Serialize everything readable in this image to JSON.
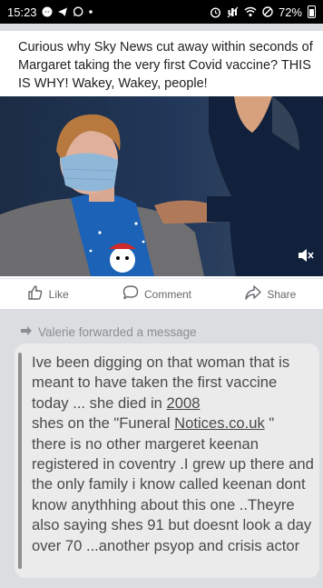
{
  "status_bar": {
    "time": "15:23",
    "battery": "72%",
    "left_icons": [
      "messenger-icon",
      "telegram-icon",
      "whatsapp-icon",
      "dot-icon"
    ],
    "right_icons": [
      "alarm-icon",
      "mute-icon",
      "wifi-icon",
      "do-not-disturb-icon",
      "battery-icon"
    ]
  },
  "post": {
    "text": "Curious why Sky News cut away within seconds of Margaret taking the very first Covid vaccine? THIS IS WHY! Wakey, Wakey, people!",
    "actions": {
      "like_label": "Like",
      "comment_label": "Comment",
      "share_label": "Share"
    }
  },
  "forwarded": {
    "label": "Valerie forwarded a message"
  },
  "message": {
    "part1": "Ive been digging on that woman that is meant to have taken the first vaccine today ... she died in ",
    "link1": "2008",
    "part2": "\nshes on the \"Funeral ",
    "link2": "Notices.co.uk",
    "part3": " \"\nthere is no other margeret keenan registered in coventry .I grew up there and the only family i know called keenan dont know anythhing about this one ..Theyre also saying shes 91 but doesnt look a day over 70 ...another psyop and crisis actor"
  }
}
